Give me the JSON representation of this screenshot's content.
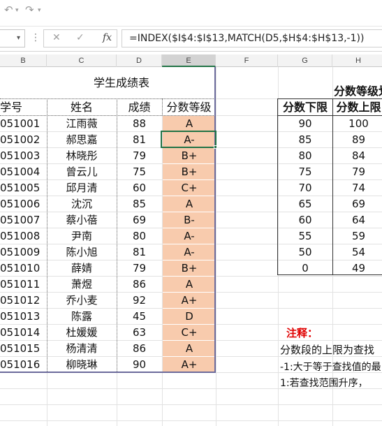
{
  "toolbar": {
    "undo_icon": "undo-icon",
    "redo_icon": "redo-icon",
    "undo_caret": "▾",
    "redo_caret": "▾"
  },
  "formula_bar": {
    "namebox_caret": "▾",
    "dots": "⋮",
    "cancel": "✕",
    "confirm": "✓",
    "fx": "fx",
    "formula": "=INDEX($I$4:$I$13,MATCH(D5,$H$4:$H$13,-1))"
  },
  "columns": [
    "B",
    "C",
    "D",
    "E",
    "F",
    "G",
    "H"
  ],
  "sheet": {
    "title": "学生成绩表",
    "headers": {
      "id": "学号",
      "name": "姓名",
      "score": "成绩",
      "grade": "分数等级"
    },
    "students": [
      {
        "id": "051001",
        "name": "江雨薇",
        "score": "88",
        "grade": "A"
      },
      {
        "id": "051002",
        "name": "郝思嘉",
        "score": "81",
        "grade": "A-"
      },
      {
        "id": "051003",
        "name": "林晓彤",
        "score": "79",
        "grade": "B+"
      },
      {
        "id": "051004",
        "name": "曾云儿",
        "score": "75",
        "grade": "B+"
      },
      {
        "id": "051005",
        "name": "邱月清",
        "score": "60",
        "grade": "C+"
      },
      {
        "id": "051006",
        "name": "沈沉",
        "score": "85",
        "grade": "A"
      },
      {
        "id": "051007",
        "name": "蔡小蓓",
        "score": "69",
        "grade": "B-"
      },
      {
        "id": "051008",
        "name": "尹南",
        "score": "80",
        "grade": "A-"
      },
      {
        "id": "051009",
        "name": "陈小旭",
        "score": "81",
        "grade": "A-"
      },
      {
        "id": "051010",
        "name": "薛婧",
        "score": "79",
        "grade": "B+"
      },
      {
        "id": "051011",
        "name": "萧煜",
        "score": "86",
        "grade": "A"
      },
      {
        "id": "051012",
        "name": "乔小麦",
        "score": "92",
        "grade": "A+"
      },
      {
        "id": "051013",
        "name": "陈露",
        "score": "45",
        "grade": "D"
      },
      {
        "id": "051014",
        "name": "杜媛媛",
        "score": "63",
        "grade": "C+"
      },
      {
        "id": "051015",
        "name": "杨清清",
        "score": "86",
        "grade": "A"
      },
      {
        "id": "051016",
        "name": "柳晓琳",
        "score": "90",
        "grade": "A+"
      }
    ]
  },
  "grade_table": {
    "title": "分数等级划",
    "headers": {
      "lower": "分数下限",
      "upper": "分数上限"
    },
    "rows": [
      {
        "lower": "90",
        "upper": "100"
      },
      {
        "lower": "85",
        "upper": "89"
      },
      {
        "lower": "80",
        "upper": "84"
      },
      {
        "lower": "75",
        "upper": "79"
      },
      {
        "lower": "70",
        "upper": "74"
      },
      {
        "lower": "65",
        "upper": "69"
      },
      {
        "lower": "60",
        "upper": "64"
      },
      {
        "lower": "55",
        "upper": "59"
      },
      {
        "lower": "50",
        "upper": "54"
      },
      {
        "lower": "0",
        "upper": "49"
      }
    ]
  },
  "notes": {
    "title": "注释：",
    "lines": [
      "分数段的上限为查找",
      "-1:大于等于查找值的最",
      "1:若查找范围升序，"
    ]
  },
  "colors": {
    "grade_fill": "#f8cbad",
    "excel_green": "#217346",
    "note_red": "#e00000",
    "table_border": "#6b6a9b"
  }
}
